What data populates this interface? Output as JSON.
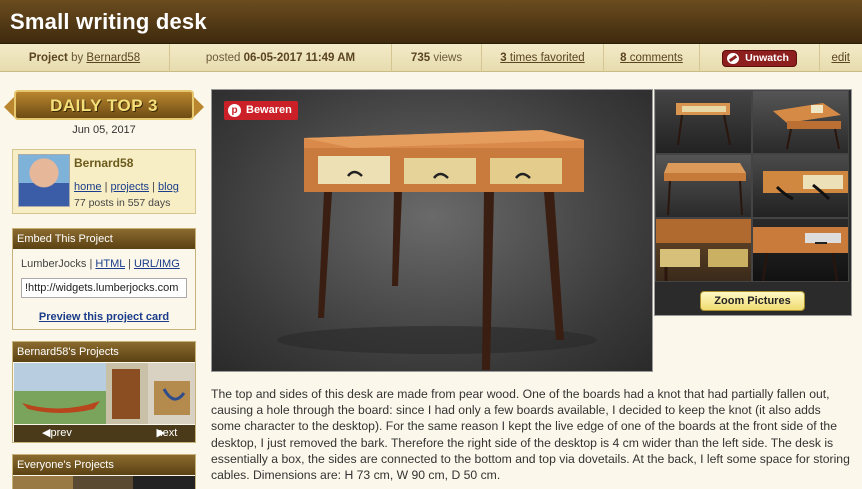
{
  "page": {
    "title": "Small writing desk"
  },
  "meta": {
    "project_word": "Project",
    "by_word": "by",
    "author": "Bernard58",
    "posted_word": "posted",
    "posted_date": "06-05-2017 11:49 AM",
    "views_count": "735",
    "views_word": "views",
    "favorited_count": "3",
    "favorited_word": "times favorited",
    "comments_count": "8",
    "comments_word": "comments",
    "unwatch_label": "Unwatch",
    "edit_label": "edit"
  },
  "sidebar": {
    "badge": "DAILY TOP 3",
    "badge_date": "Jun 05, 2017",
    "user": {
      "name": "Bernard58",
      "links": [
        "home",
        "projects",
        "blog"
      ],
      "stats": "77 posts in 557 days"
    },
    "embed": {
      "title": "Embed This Project",
      "links": [
        "LumberJocks",
        "HTML",
        "URL/IMG"
      ],
      "input_value": "!http://widgets.lumberjocks.com",
      "preview_label": "Preview this project card"
    },
    "projects": {
      "title": "Bernard58's Projects",
      "prev_label": "prev",
      "next_label": "next"
    },
    "everyone": {
      "title": "Everyone's Projects"
    }
  },
  "main": {
    "pin_label": "Bewaren",
    "zoom_label": "Zoom Pictures",
    "description": "The top and sides of this desk are made from pear wood. One of the boards had a knot that had partially fallen out, causing a hole through the board: since I had only a few boards available, I decided to keep the knot (it also adds some character to the desktop). For the same reason I kept the live edge of one of the boards at the front side of the desktop, I just removed the bark. Therefore the right side of the desktop is 4 cm wider than the left side. The desk is essentially a box, the sides are connected to the bottom and top via dovetails. At the back, I left some space for storing cables. Dimensions are: H 73 cm, W 90 cm, D 50 cm."
  },
  "colors": {
    "header_bg": "#4f3714",
    "meta_bg": "#efe4bc",
    "unwatch_red": "#8e1f1f",
    "pinterest_red": "#cb2027",
    "link_blue": "#1a3c8a"
  }
}
